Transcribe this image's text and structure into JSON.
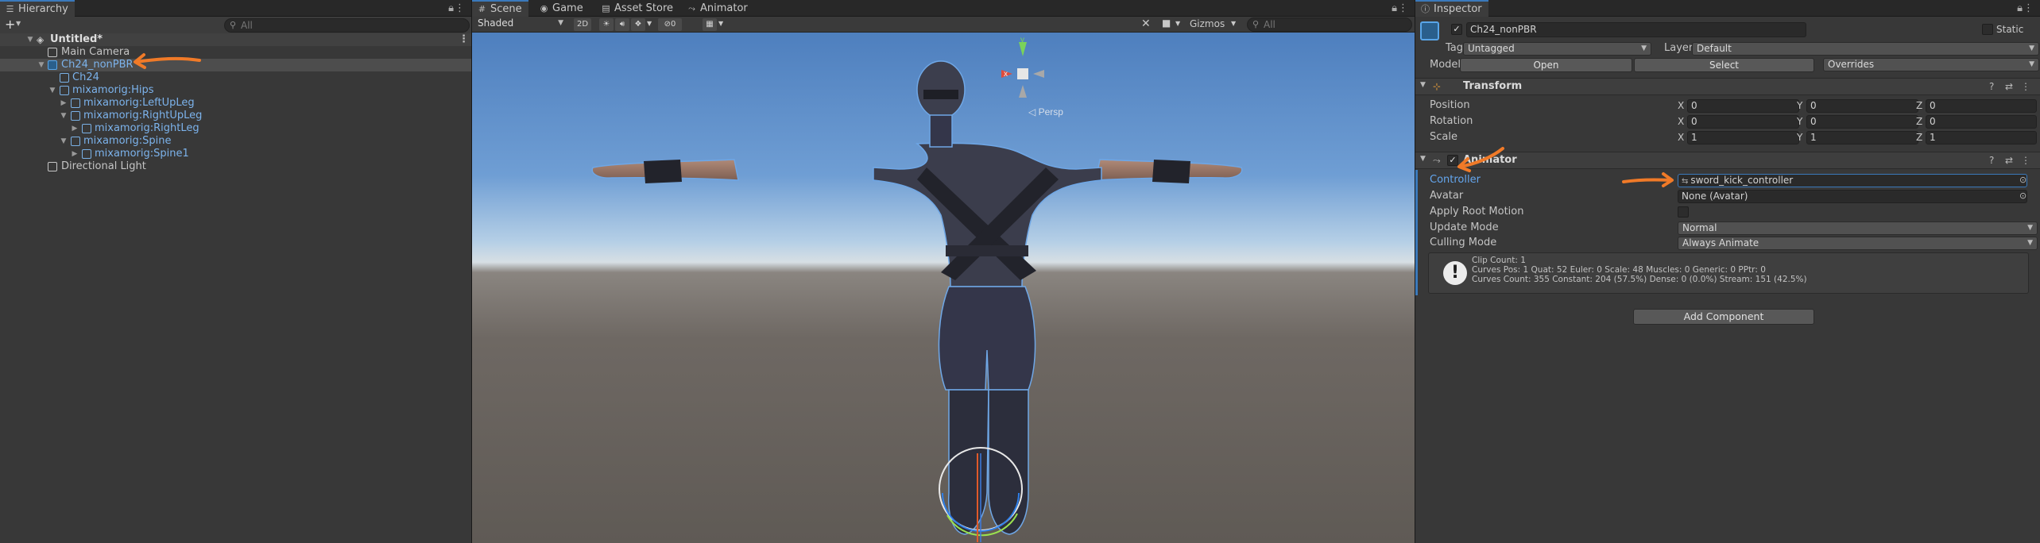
{
  "hierarchy": {
    "tab_label": "Hierarchy",
    "search_placeholder": "All",
    "add_label": "+",
    "scene_name": "Untitled*",
    "items": [
      {
        "label": "Main Camera"
      },
      {
        "label": "Ch24_nonPBR"
      },
      {
        "label": "Ch24"
      },
      {
        "label": "mixamorig:Hips"
      },
      {
        "label": "mixamorig:LeftUpLeg"
      },
      {
        "label": "mixamorig:RightUpLeg"
      },
      {
        "label": "mixamorig:RightLeg"
      },
      {
        "label": "mixamorig:Spine"
      },
      {
        "label": "mixamorig:Spine1"
      },
      {
        "label": "Directional Light"
      }
    ]
  },
  "scene": {
    "tabs": [
      {
        "label": "Scene"
      },
      {
        "label": "Game"
      },
      {
        "label": "Asset Store"
      },
      {
        "label": "Animator"
      }
    ],
    "shading_mode": "Shaded",
    "mode_2d": "2D",
    "hidden_count": "0",
    "gizmos_label": "Gizmos",
    "search_placeholder": "All",
    "gizmo_x": "x",
    "gizmo_y": "y",
    "persp_label": "◁ Persp"
  },
  "inspector": {
    "tab_label": "Inspector",
    "object_name": "Ch24_nonPBR",
    "static_label": "Static",
    "tag_label": "Tag",
    "tag_value": "Untagged",
    "layer_label": "Layer",
    "layer_value": "Default",
    "model_label": "Model",
    "open_label": "Open",
    "select_label": "Select",
    "overrides_label": "Overrides",
    "transform": {
      "title": "Transform",
      "rows": [
        {
          "label": "Position",
          "x": "0",
          "y": "0",
          "z": "0"
        },
        {
          "label": "Rotation",
          "x": "0",
          "y": "0",
          "z": "0"
        },
        {
          "label": "Scale",
          "x": "1",
          "y": "1",
          "z": "1"
        }
      ],
      "axis_x": "X",
      "axis_y": "Y",
      "axis_z": "Z"
    },
    "animator": {
      "title": "Animator",
      "controller_label": "Controller",
      "controller_value": "sword_kick_controller",
      "avatar_label": "Avatar",
      "avatar_value": "None (Avatar)",
      "root_motion_label": "Apply Root Motion",
      "update_mode_label": "Update Mode",
      "update_mode_value": "Normal",
      "culling_mode_label": "Culling Mode",
      "culling_mode_value": "Always Animate",
      "info_line1": "Clip Count: 1",
      "info_line2": "Curves Pos: 1 Quat: 52 Euler: 0 Scale: 48 Muscles: 0 Generic: 0 PPtr: 0",
      "info_line3": "Curves Count: 355 Constant: 204 (57.5%) Dense: 0 (0.0%) Stream: 151 (42.5%)"
    },
    "add_component_label": "Add Component"
  },
  "colors": {
    "accent": "#3a79bb",
    "annotation": "#f07a28",
    "prefab_text": "#7cb3ec"
  }
}
